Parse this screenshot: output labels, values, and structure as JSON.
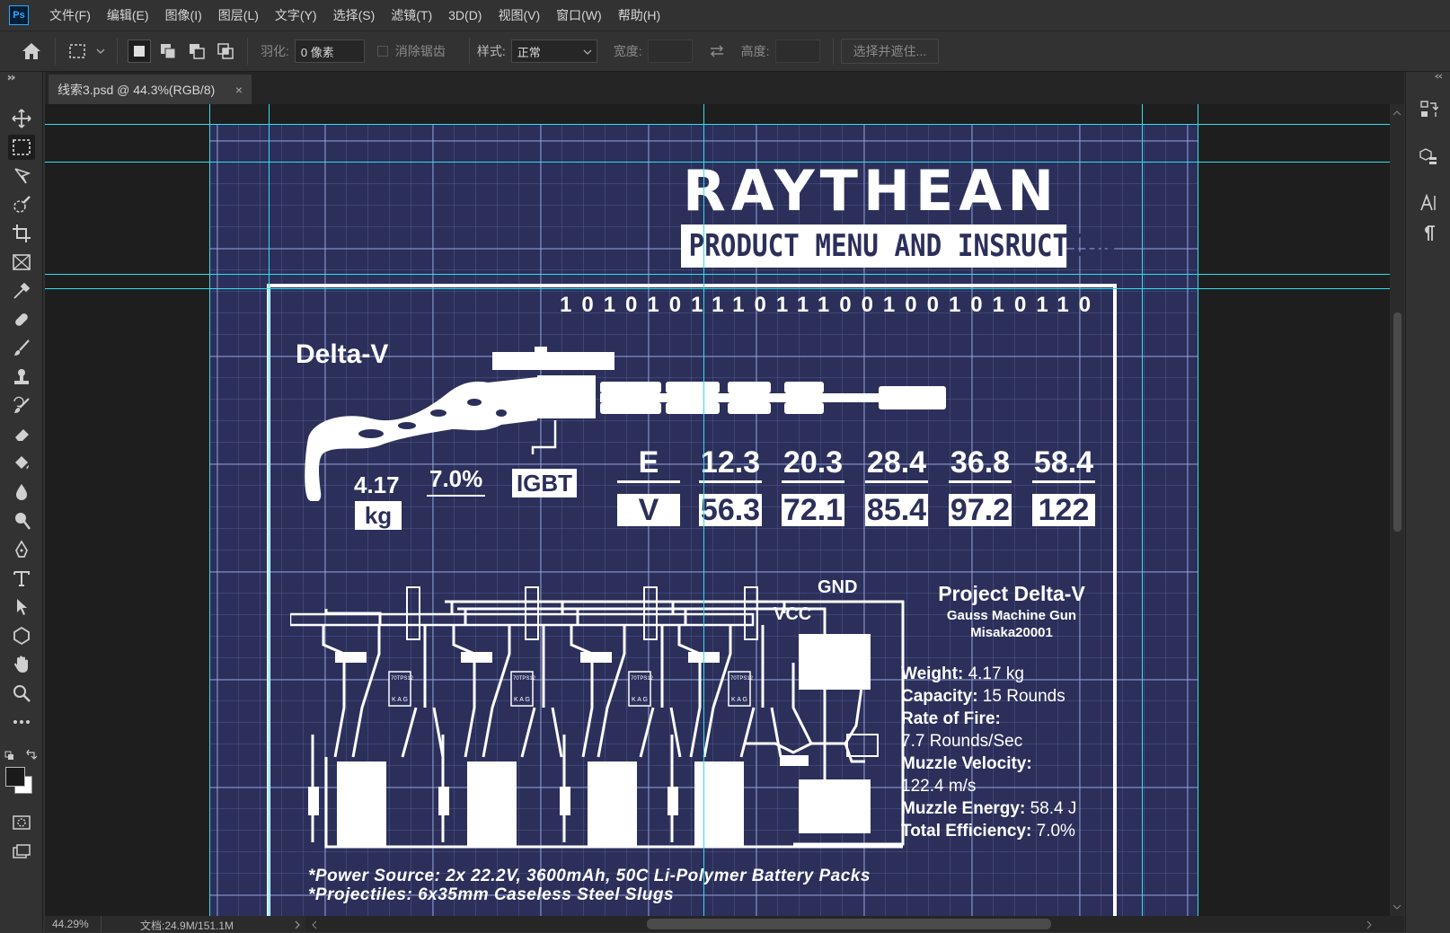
{
  "menu": [
    "文件(F)",
    "编辑(E)",
    "图像(I)",
    "图层(L)",
    "文字(Y)",
    "选择(S)",
    "滤镜(T)",
    "3D(D)",
    "视图(V)",
    "窗口(W)",
    "帮助(H)"
  ],
  "options": {
    "feather_label": "羽化:",
    "feather_value": "0 像素",
    "antialias_label": "消除锯齿",
    "style_label": "样式:",
    "style_value": "正常",
    "width_label": "宽度:",
    "height_label": "高度:",
    "select_mask_label": "选择并遮住..."
  },
  "tab": {
    "title": "线索3.psd @ 44.3%(RGB/8)",
    "close": "×"
  },
  "status": {
    "zoom": "44.29%",
    "doc": "文档:24.9M/151.1M"
  },
  "artwork": {
    "logo": "RAYTHEAN",
    "subtitle": "PRODUCT MENU AND INSRUCTION",
    "binary": "1010101110111001001010110",
    "model": "Delta-V",
    "weight_value": "4.17",
    "weight_unit": "kg",
    "efficiency": "7.0%",
    "igbt": "IGBT",
    "energy_label": "E",
    "velocity_label": "V",
    "energy": [
      "12.3",
      "20.3",
      "28.4",
      "36.8",
      "58.4"
    ],
    "velocity": [
      "56.3",
      "72.1",
      "85.4",
      "97.2",
      "122"
    ],
    "gnd": "GND",
    "vcc": "VCC",
    "chip": "70TPS12",
    "chip_pins": "K A G",
    "project_title": "Project Delta-V",
    "project_sub1": "Gauss Machine Gun",
    "project_sub2": "Misaka20001",
    "specs": [
      {
        "label": "Weight:",
        "value": " 4.17 kg"
      },
      {
        "label": "Capacity:",
        "value": " 15 Rounds"
      },
      {
        "label": "Rate of Fire:",
        "value": ""
      },
      {
        "label": "",
        "value": "7.7 Rounds/Sec"
      },
      {
        "label": "Muzzle Velocity:",
        "value": ""
      },
      {
        "label": "",
        "value": "122.4 m/s"
      },
      {
        "label": "Muzzle Energy:",
        "value": " 58.4 J"
      },
      {
        "label": "Total Efficiency:",
        "value": " 7.0%"
      }
    ],
    "foot1": "*Power Source: 2x 22.2V, 3600mAh, 50C Li-Polymer Battery Packs",
    "foot2": "*Projectiles: 6x35mm Caseless Steel Slugs"
  },
  "colors": {
    "accent": "#31a8ff",
    "blueprint_bg": "#2b2f5a",
    "guide": "#2fe0f0"
  }
}
